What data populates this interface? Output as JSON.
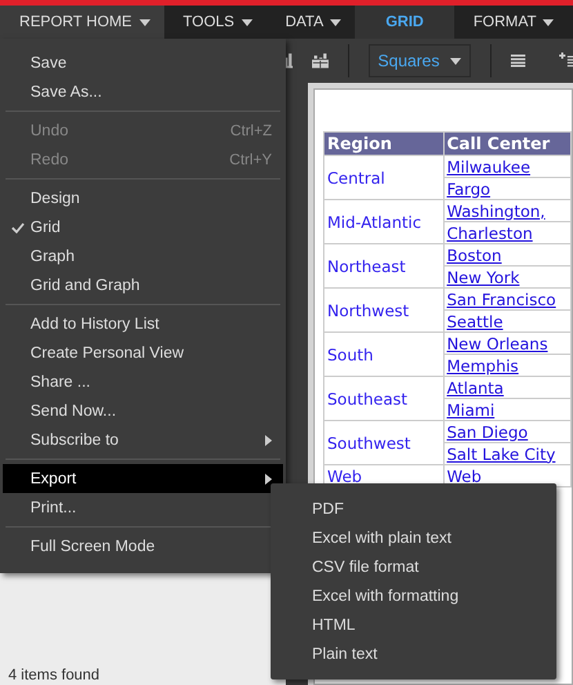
{
  "tabs": [
    {
      "label": "REPORT HOME",
      "selected": false,
      "open": true,
      "dropdown": true
    },
    {
      "label": "TOOLS",
      "selected": false,
      "open": false,
      "dropdown": true
    },
    {
      "label": "DATA",
      "selected": false,
      "open": false,
      "dropdown": true
    },
    {
      "label": "GRID",
      "selected": true,
      "open": false,
      "dropdown": false
    },
    {
      "label": "FORMAT",
      "selected": false,
      "open": false,
      "dropdown": true
    }
  ],
  "toolbar": {
    "shape_select": {
      "value": "Squares"
    }
  },
  "menu": {
    "groups": [
      [
        {
          "label": "Save",
          "disabled": false,
          "checked": false,
          "highlighted": false,
          "submenu": false
        },
        {
          "label": "Save As...",
          "disabled": false,
          "checked": false,
          "highlighted": false,
          "submenu": false
        }
      ],
      [
        {
          "label": "Undo",
          "shortcut": "Ctrl+Z",
          "disabled": true,
          "checked": false,
          "highlighted": false,
          "submenu": false
        },
        {
          "label": "Redo",
          "shortcut": "Ctrl+Y",
          "disabled": true,
          "checked": false,
          "highlighted": false,
          "submenu": false
        }
      ],
      [
        {
          "label": "Design",
          "disabled": false,
          "checked": false,
          "highlighted": false,
          "submenu": false
        },
        {
          "label": "Grid",
          "disabled": false,
          "checked": true,
          "highlighted": false,
          "submenu": false
        },
        {
          "label": "Graph",
          "disabled": false,
          "checked": false,
          "highlighted": false,
          "submenu": false
        },
        {
          "label": "Grid and Graph",
          "disabled": false,
          "checked": false,
          "highlighted": false,
          "submenu": false
        }
      ],
      [
        {
          "label": "Add to History List",
          "disabled": false,
          "checked": false,
          "highlighted": false,
          "submenu": false
        },
        {
          "label": "Create Personal View",
          "disabled": false,
          "checked": false,
          "highlighted": false,
          "submenu": false
        },
        {
          "label": "Share ...",
          "disabled": false,
          "checked": false,
          "highlighted": false,
          "submenu": false
        },
        {
          "label": "Send Now...",
          "disabled": false,
          "checked": false,
          "highlighted": false,
          "submenu": false
        },
        {
          "label": "Subscribe to",
          "disabled": false,
          "checked": false,
          "highlighted": false,
          "submenu": true
        }
      ],
      [
        {
          "label": "Export",
          "disabled": false,
          "checked": false,
          "highlighted": true,
          "submenu": true
        },
        {
          "label": "Print...",
          "disabled": false,
          "checked": false,
          "highlighted": false,
          "submenu": false
        }
      ],
      [
        {
          "label": "Full Screen Mode",
          "disabled": false,
          "checked": false,
          "highlighted": false,
          "submenu": false
        }
      ]
    ]
  },
  "export_submenu": [
    "PDF",
    "Excel with plain text",
    "CSV file format",
    "Excel with formatting",
    "HTML",
    "Plain text"
  ],
  "table": {
    "columns": [
      "Region",
      "Call Center"
    ],
    "rows": [
      {
        "region": "Central",
        "call_centers": [
          "Milwaukee",
          "Fargo"
        ]
      },
      {
        "region": "Mid-Atlantic",
        "call_centers": [
          "Washington,",
          "Charleston"
        ]
      },
      {
        "region": "Northeast",
        "call_centers": [
          "Boston",
          "New York"
        ]
      },
      {
        "region": "Northwest",
        "call_centers": [
          "San Francisco",
          "Seattle"
        ]
      },
      {
        "region": "South",
        "call_centers": [
          "New Orleans",
          "Memphis"
        ]
      },
      {
        "region": "Southeast",
        "call_centers": [
          "Atlanta",
          "Miami"
        ]
      },
      {
        "region": "Southwest",
        "call_centers": [
          "San Diego",
          "Salt Lake City"
        ]
      },
      {
        "region": "Web",
        "call_centers": [
          "Web"
        ]
      }
    ]
  },
  "status": "4 items found"
}
